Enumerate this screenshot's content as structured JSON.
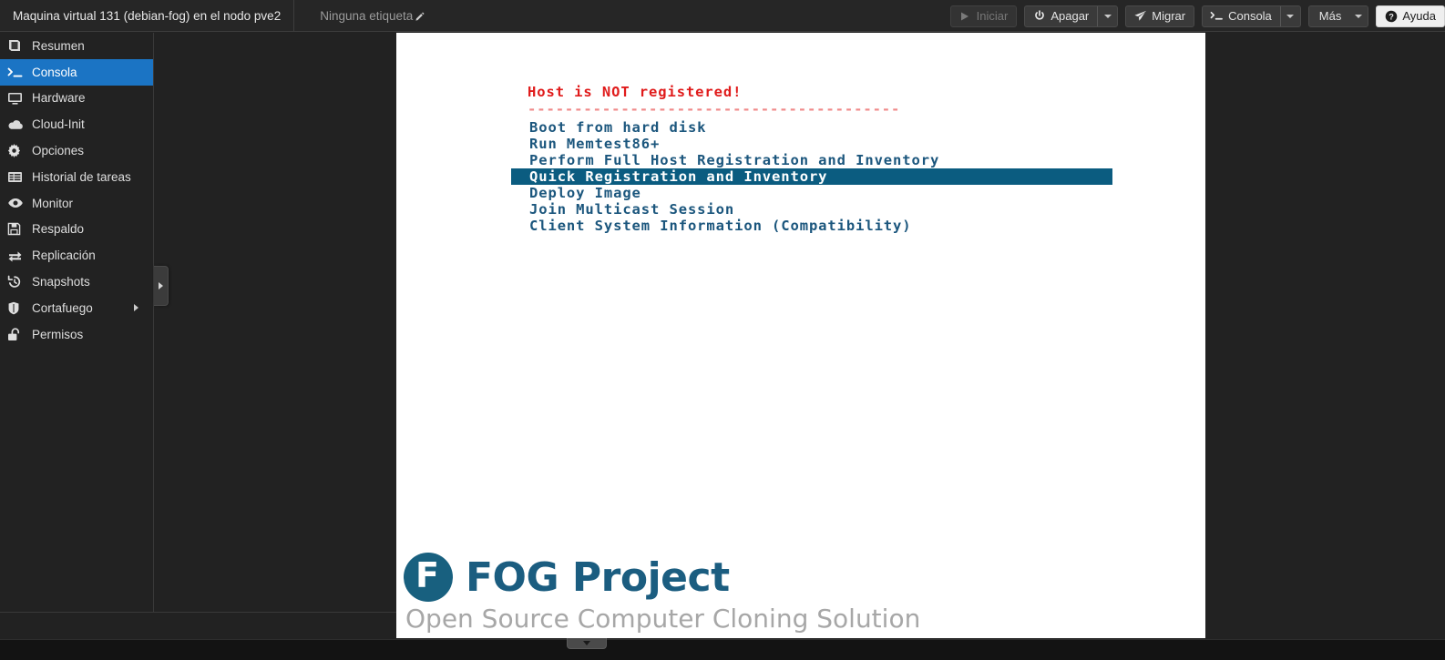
{
  "header": {
    "title": "Maquina virtual 131 (debian-fog) en el nodo pve2",
    "tag": "Ninguna etiqueta",
    "tag_edit_icon": "pencil-icon"
  },
  "toolbar": {
    "buttons": [
      {
        "label": "Iniciar",
        "icon": "play-icon",
        "disabled": true,
        "split": false,
        "caret": false,
        "style": "dark"
      },
      {
        "label": "Apagar",
        "icon": "power-icon",
        "disabled": false,
        "split": true,
        "caret": true,
        "style": "dark"
      },
      {
        "label": "Migrar",
        "icon": "send-icon",
        "disabled": false,
        "split": false,
        "caret": false,
        "style": "dark"
      },
      {
        "label": "Consola",
        "icon": "terminal-icon",
        "disabled": false,
        "split": true,
        "caret": true,
        "style": "dark"
      },
      {
        "label": "Más",
        "icon": "none",
        "disabled": false,
        "split": false,
        "caret": true,
        "style": "dark"
      },
      {
        "label": "Ayuda",
        "icon": "help-icon",
        "disabled": false,
        "split": false,
        "caret": false,
        "style": "light"
      }
    ]
  },
  "sidebar": {
    "active_index": 1,
    "items": [
      {
        "label": "Resumen",
        "icon": "book-icon",
        "submenu": false
      },
      {
        "label": "Consola",
        "icon": "terminal-icon",
        "submenu": false
      },
      {
        "label": "Hardware",
        "icon": "monitor-icon",
        "submenu": false
      },
      {
        "label": "Cloud-Init",
        "icon": "cloud-icon",
        "submenu": false
      },
      {
        "label": "Opciones",
        "icon": "gear-icon",
        "submenu": false
      },
      {
        "label": "Historial de tareas",
        "icon": "list-icon",
        "submenu": false
      },
      {
        "label": "Monitor",
        "icon": "eye-icon",
        "submenu": false
      },
      {
        "label": "Respaldo",
        "icon": "save-icon",
        "submenu": false
      },
      {
        "label": "Replicación",
        "icon": "sync-icon",
        "submenu": false
      },
      {
        "label": "Snapshots",
        "icon": "history-icon",
        "submenu": false
      },
      {
        "label": "Cortafuego",
        "icon": "shield-icon",
        "submenu": true
      },
      {
        "label": "Permisos",
        "icon": "unlock-icon",
        "submenu": false
      }
    ],
    "collapse_handle_icon": "chevron-right-icon"
  },
  "console": {
    "boot_menu": {
      "heading": "Host is NOT registered!",
      "rule": "----------------------------------------",
      "selected_index": 3,
      "options": [
        "Boot from hard disk",
        "Run Memtest86+",
        "Perform Full Host Registration and Inventory",
        "Quick Registration and Inventory",
        "Deploy Image",
        "Join Multicast Session",
        "Client System Information (Compatibility)"
      ]
    },
    "logo": {
      "badge_letter": "F",
      "wordmark": "FOG Project",
      "tagline": "Open Source Computer Cloning Solution"
    },
    "bottom_tab_icon": "chevron-down-icon"
  },
  "colors": {
    "accent_blue": "#1b74c4",
    "console_bg": "#ffffff",
    "menu_text": "#1b567d",
    "menu_highlight": "#0b5c80",
    "alert_red": "#e01b1b",
    "rule_red": "#f08a8a",
    "logo_teal": "#18607f",
    "tagline_gray": "#a7a7a7",
    "chrome_bg": "#222222",
    "button_bg": "#3a3a3a"
  }
}
